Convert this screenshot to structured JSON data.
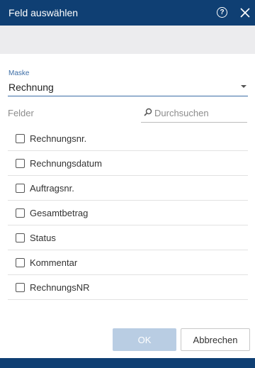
{
  "dialog": {
    "title": "Feld auswählen",
    "help_icon": "question-circle-icon",
    "close_icon": "close-icon"
  },
  "mask": {
    "label": "Maske",
    "selected": "Rechnung"
  },
  "fields": {
    "label": "Felder",
    "search_placeholder": "Durchsuchen",
    "items": [
      {
        "label": "Rechnungsnr.",
        "checked": false
      },
      {
        "label": "Rechnungsdatum",
        "checked": false
      },
      {
        "label": "Auftragsnr.",
        "checked": false
      },
      {
        "label": "Gesamtbetrag",
        "checked": false
      },
      {
        "label": "Status",
        "checked": false
      },
      {
        "label": "Kommentar",
        "checked": false
      },
      {
        "label": "RechnungsNR",
        "checked": false
      }
    ]
  },
  "buttons": {
    "ok": "OK",
    "cancel": "Abbrechen"
  },
  "colors": {
    "titlebar": "#0f3f73",
    "accent": "#3d6da6",
    "ok_disabled": "#b9cde3"
  }
}
